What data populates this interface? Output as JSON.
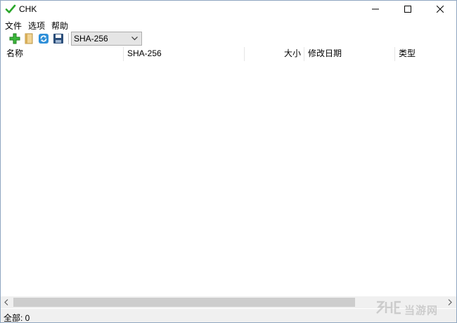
{
  "window": {
    "title": "CHK"
  },
  "menu": {
    "items": [
      "文件",
      "选项",
      "帮助"
    ]
  },
  "toolbar": {
    "icons": [
      "add-icon",
      "open-icon",
      "refresh-icon",
      "save-icon"
    ],
    "algorithm": {
      "selected": "SHA-256"
    }
  },
  "list": {
    "columns": [
      "名称",
      "SHA-256",
      "大小",
      "修改日期",
      "类型"
    ],
    "rows": []
  },
  "status": {
    "text": "全部: 0"
  },
  "watermark": {
    "text": "当游网"
  },
  "colors": {
    "accent_green": "#2aa62a",
    "scroll_thumb": "#cdcdcd",
    "status_bg": "#f0f0f0"
  }
}
